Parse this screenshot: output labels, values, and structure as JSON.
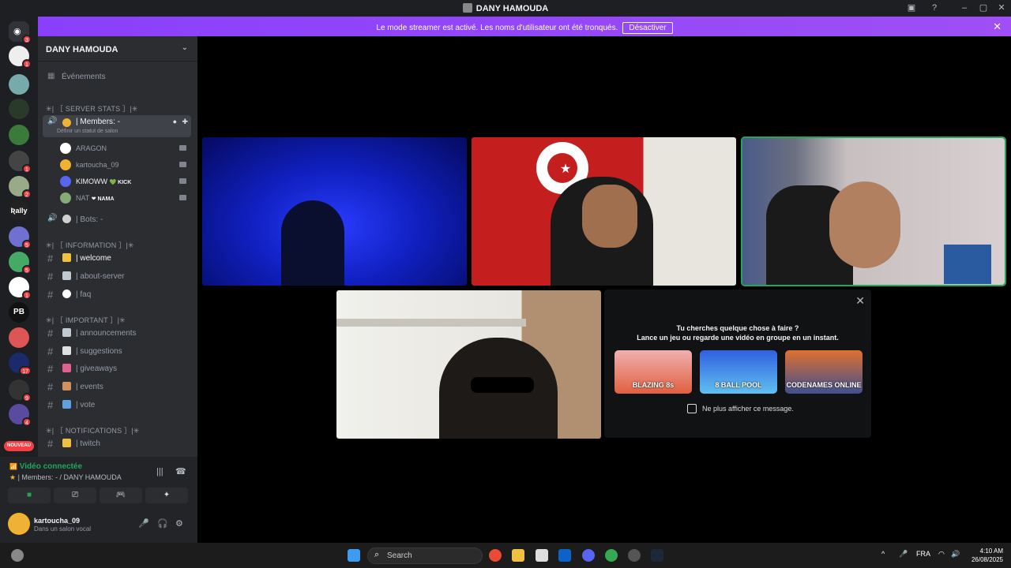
{
  "window": {
    "title": "DANY HAMOUDA"
  },
  "banner": {
    "text": "Le mode streamer est activé. Les noms d'utilisateur ont été tronqués.",
    "button": "Désactiver"
  },
  "servers": {
    "badges": [
      "3",
      "1",
      "1",
      "1",
      "2",
      "5",
      "5",
      "1",
      "17",
      "9",
      "4"
    ],
    "new_label": "NOUVEAU",
    "rally_label": "Ʀally"
  },
  "sidebar": {
    "server_name": "DANY HAMOUDA",
    "events": "Événements",
    "cat_stats": "✳| ［ SERVER STATS ］|✳",
    "members_channel": "| Members: -",
    "members_sub": "Définir un statut de salon",
    "voice_users": [
      {
        "name": "ARAGON",
        "color": "#f2f3f5"
      },
      {
        "name": "kartoucha_09",
        "color": "#949ba4"
      },
      {
        "name": "KIMOWW",
        "tag": "💚 KICK",
        "color": "#f2f3f5"
      },
      {
        "name": "NAT",
        "tag": "❤ NAMA",
        "color": "#949ba4"
      }
    ],
    "bots_channel": "| Bots: -",
    "cat_info": "✳| ［ INFORMATION ］|✳",
    "info_channels": [
      "| welcome",
      "| about-server",
      "| faq"
    ],
    "cat_important": "✳| ［ IMPORTANT ］|✳",
    "important_channels": [
      "| announcements",
      "| suggestions",
      "| giveaways",
      "| events",
      "| vote"
    ],
    "cat_notifications": "✳| ［ NOTIFICATIONS ］|✳",
    "notification_channels": [
      "| twitch"
    ]
  },
  "voice": {
    "status": "Vidéo connectée",
    "channel": "| Members: - / DANY HAMOUDA"
  },
  "user": {
    "name": "kartoucha_09",
    "status": "Dans un salon vocal"
  },
  "activity": {
    "line1": "Tu cherches quelque chose à faire ?",
    "line2": "Lance un jeu ou regarde une vidéo en groupe en un instant.",
    "games": [
      "BLAZING 8s",
      "8 BALL POOL",
      "CODENAMES ONLINE"
    ],
    "checkbox": "Ne plus afficher ce message."
  },
  "taskbar": {
    "search": "Search",
    "lang": "FRA",
    "time": "4:10 AM",
    "date": "26/08/2025"
  },
  "colors": {
    "accent": "#5865f2",
    "banner": "#9b51e0",
    "online": "#23a55a",
    "badge": "#f23f43"
  }
}
